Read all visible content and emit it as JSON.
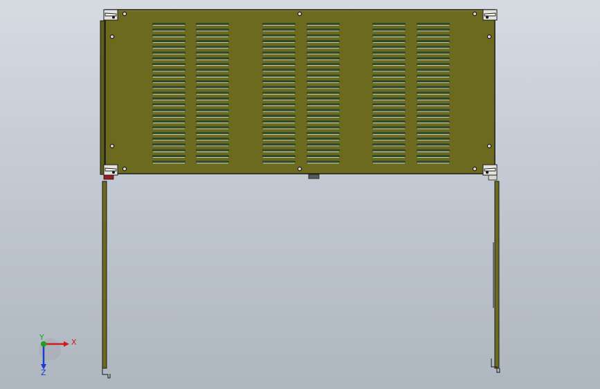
{
  "viewport": {
    "background_top": "#d6dbe2",
    "background_bottom": "#aeb6c0"
  },
  "model": {
    "panel_color": "#6b6a1e",
    "slot_color": "#2f4a2a",
    "slot_highlight": "#e9eae0",
    "outline_color": "#1a1a1a",
    "screw_color": "#1c1c1c",
    "bracket_color": "#7a7a2a",
    "red_marker_color": "#a01b1b",
    "gray_tab_color": "#5a5a5a",
    "slot_columns": 6,
    "slots_per_column": 25,
    "panel_description_icon": "ventilated-cover-panel"
  },
  "triad": {
    "x_label": "X",
    "y_label": "Y",
    "z_label": "Z",
    "x_color": "#d11a1a",
    "y_color": "#1aa31a",
    "z_color": "#1a3ad1"
  }
}
